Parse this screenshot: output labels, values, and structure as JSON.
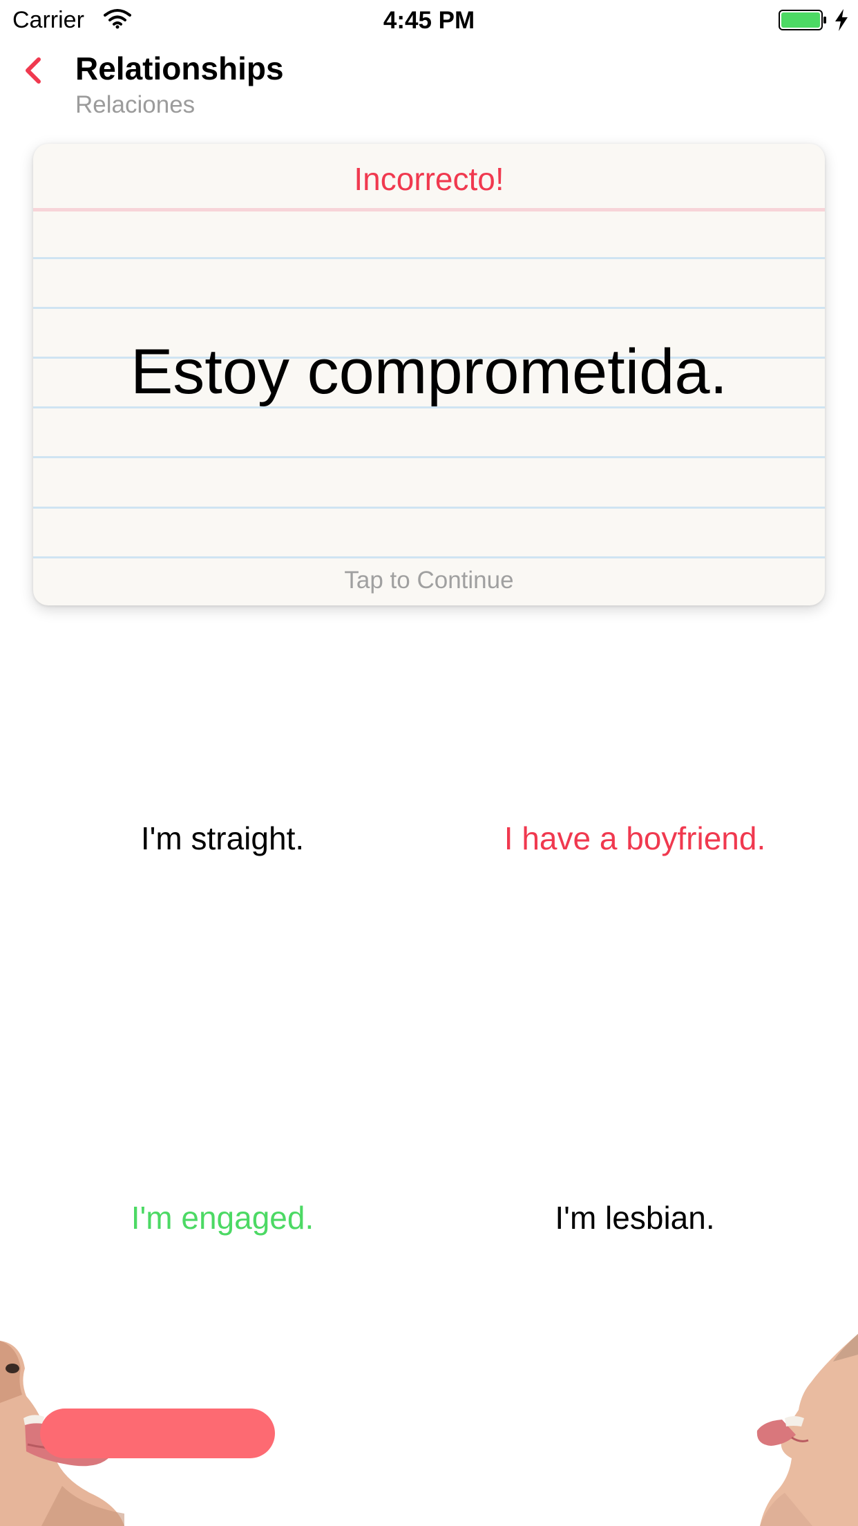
{
  "status_bar": {
    "carrier": "Carrier",
    "time": "4:45 PM",
    "battery_color": "#4cd964"
  },
  "nav": {
    "back_icon": "chevron-left-icon",
    "title": "Relationships",
    "subtitle": "Relaciones",
    "accent_color": "#f0394f"
  },
  "card": {
    "status": "Incorrecto!",
    "phrase": "Estoy comprometida.",
    "hint": "Tap to Continue"
  },
  "answers": [
    {
      "label": "I'm straight.",
      "state": "neutral"
    },
    {
      "label": "I have a boyfriend.",
      "state": "wrong"
    },
    {
      "label": "I'm engaged.",
      "state": "correct"
    },
    {
      "label": "I'm lesbian.",
      "state": "neutral"
    }
  ],
  "colors": {
    "wrong": "#f0394f",
    "correct": "#4cd964",
    "progress": "#fd6a72"
  },
  "progress": {
    "fraction": 0.27
  }
}
